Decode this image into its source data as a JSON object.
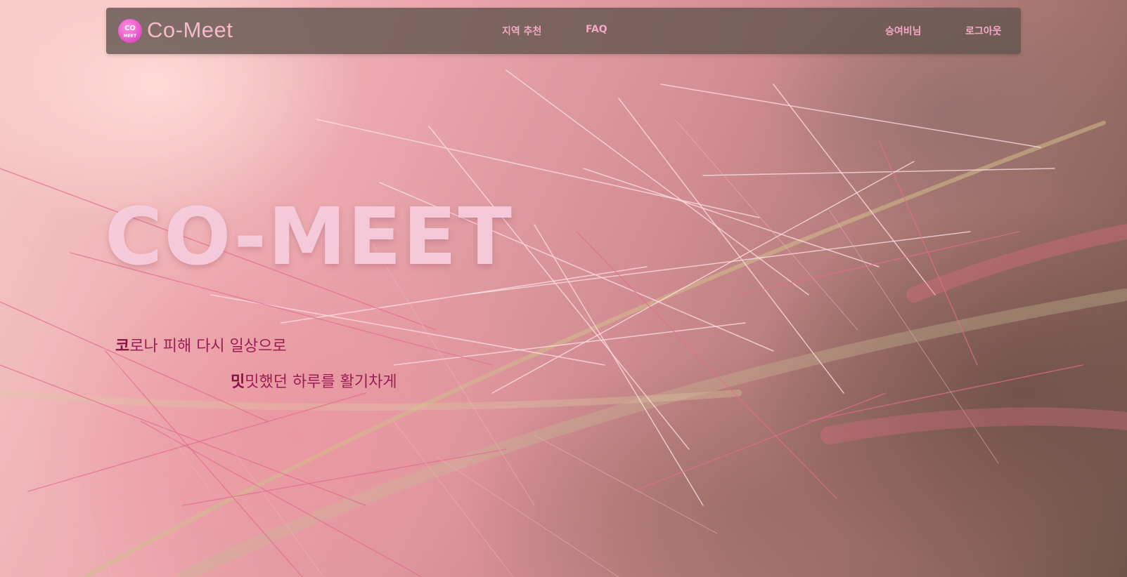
{
  "navbar": {
    "logo_top": "CO",
    "logo_bottom": "MEET",
    "brand": "Co-Meet",
    "links": [
      {
        "label": "지역 추천"
      },
      {
        "label": "FAQ"
      },
      {
        "label": "승여비님"
      },
      {
        "label": "로그아웃"
      }
    ]
  },
  "hero": {
    "title": "CO-MEET",
    "line1_bold": "코",
    "line1_rest": "로나 피해 다시 일상으로",
    "line2_bold": "밋",
    "line2_rest": "밋했던 하루를 활기차게"
  },
  "colors": {
    "brand_pink": "#f6b9cb",
    "nav_link": "#f4a8c4",
    "tagline": "#9b1d55",
    "navbar_bg": "#64554f"
  }
}
